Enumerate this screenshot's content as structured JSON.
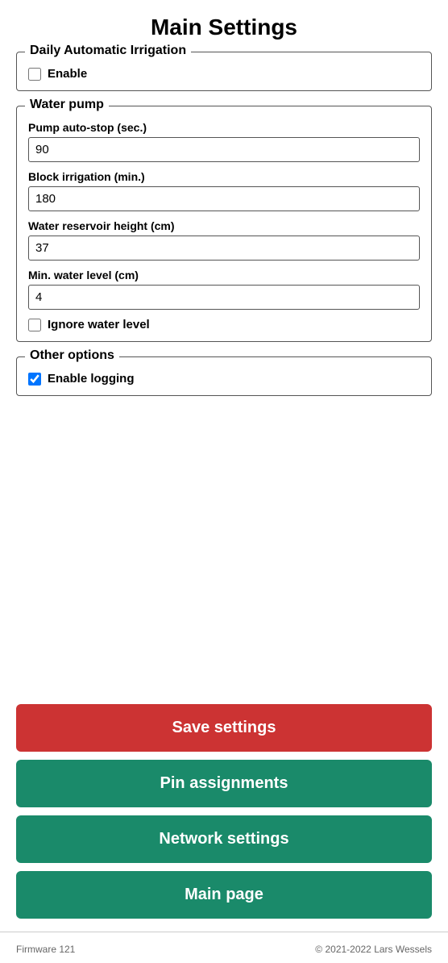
{
  "page": {
    "title": "Main Settings"
  },
  "sections": {
    "daily_irrigation": {
      "legend": "Daily Automatic Irrigation",
      "enable_label": "Enable",
      "enable_checked": false
    },
    "water_pump": {
      "legend": "Water pump",
      "fields": [
        {
          "label": "Pump auto-stop (sec.)",
          "value": "90",
          "name": "pump_autostop"
        },
        {
          "label": "Block irrigation (min.)",
          "value": "180",
          "name": "block_irrigation"
        },
        {
          "label": "Water reservoir height (cm)",
          "value": "37",
          "name": "reservoir_height"
        },
        {
          "label": "Min. water level (cm)",
          "value": "4",
          "name": "min_water_level"
        }
      ],
      "ignore_water_label": "Ignore water level",
      "ignore_water_checked": false
    },
    "other_options": {
      "legend": "Other options",
      "enable_logging_label": "Enable logging",
      "enable_logging_checked": true
    }
  },
  "buttons": {
    "save_settings": "Save settings",
    "pin_assignments": "Pin assignments",
    "network_settings": "Network settings",
    "main_page": "Main page"
  },
  "footer": {
    "firmware": "Firmware 121",
    "copyright": "© 2021-2022 Lars Wessels"
  }
}
